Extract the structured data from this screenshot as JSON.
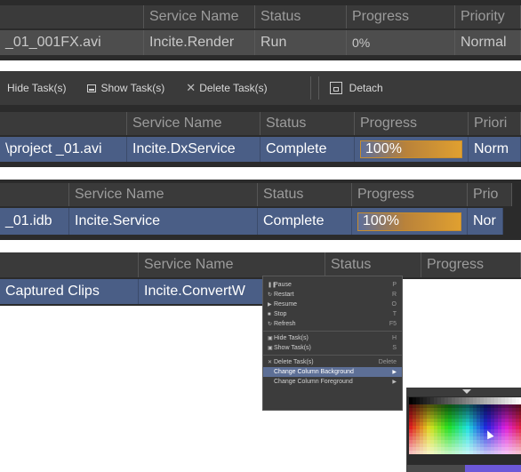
{
  "panel1": {
    "headers": [
      "",
      "Service Name",
      "Status",
      "Progress",
      "Priority"
    ],
    "row": {
      "name": "_01_001FX.avi",
      "service": "Incite.Render",
      "status": "Run",
      "progress_text": "0%",
      "priority": "Normal"
    }
  },
  "panel2": {
    "toolbar": {
      "hide": "Hide Task(s)",
      "show": "Show Task(s)",
      "delete": "Delete Task(s)",
      "detach": "Detach"
    },
    "headers": [
      "",
      "Service Name",
      "Status",
      "Progress",
      "Priori"
    ],
    "row": {
      "name": "\\project _01.avi",
      "service": "Incite.DxService",
      "status": "Complete",
      "progress_text": "100%",
      "progress": 1.0,
      "priority": "Norm"
    }
  },
  "panel3": {
    "headers": [
      "",
      "Service Name",
      "Status",
      "Progress",
      "Prio"
    ],
    "row": {
      "name": "_01.idb",
      "service": "Incite.Service",
      "status": "Complete",
      "progress_text": "100%",
      "progress": 1.0,
      "priority": "Nor"
    }
  },
  "panel4": {
    "headers": [
      "",
      "Service Name",
      "Status",
      "Progress"
    ],
    "row": {
      "name": "Captured Clips",
      "service": "Incite.ConvertW"
    }
  },
  "context_menu": {
    "items": [
      {
        "label": "Pause",
        "shortcut": "P"
      },
      {
        "label": "Restart",
        "shortcut": "R"
      },
      {
        "label": "Resume",
        "shortcut": "O"
      },
      {
        "label": "Stop",
        "shortcut": "T"
      },
      {
        "label": "Refresh",
        "shortcut": "F5"
      },
      {
        "label": "Hide Task(s)",
        "shortcut": "H"
      },
      {
        "label": "Show Task(s)",
        "shortcut": "S"
      },
      {
        "label": "Delete Task(s)",
        "shortcut": "Delete"
      },
      {
        "label": "Change Column Background"
      },
      {
        "label": "Change Column Foreground"
      }
    ]
  },
  "colors": {
    "selection_row": "#4a5e86",
    "header_bg": "#3a3a3a",
    "menu_highlight": "#5d6f96",
    "progress_orange": "#e0a030",
    "picker_accent": "#6c58d8"
  }
}
